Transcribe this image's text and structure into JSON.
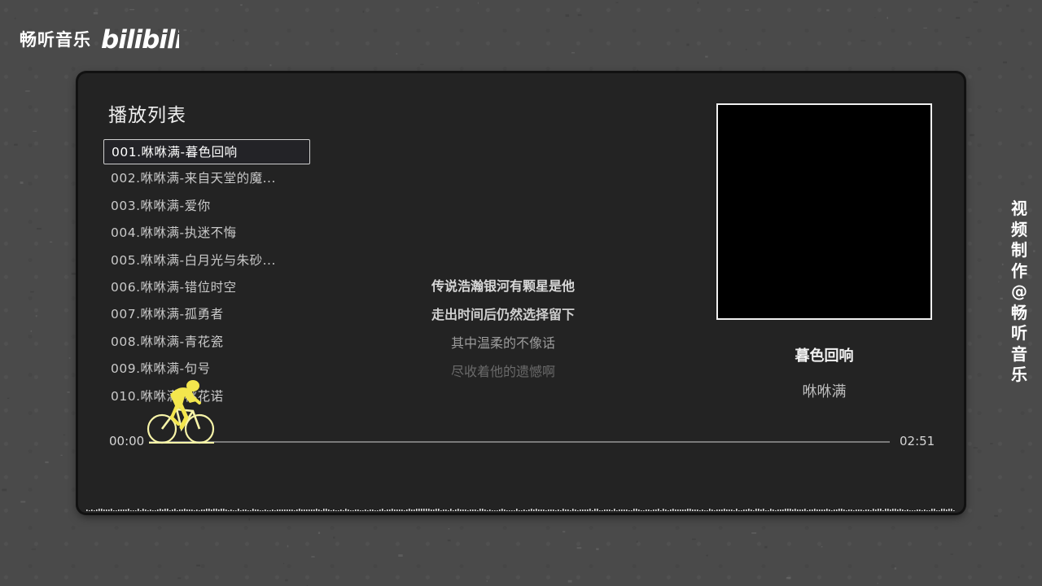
{
  "brand": {
    "name": "畅听音乐",
    "logo_text": "bilibili",
    "logo_icon": "bilibili-logo-icon"
  },
  "credit": [
    "视",
    "频",
    "制",
    "作",
    "@",
    "畅",
    "听",
    "音",
    "乐"
  ],
  "playlist": {
    "title": "播放列表",
    "items": [
      {
        "label": "001.咻咻满-暮色回响",
        "active": true
      },
      {
        "label": "002.咻咻满-来自天堂的魔...",
        "active": false
      },
      {
        "label": "003.咻咻满-爱你",
        "active": false
      },
      {
        "label": "004.咻咻满-执迷不悔",
        "active": false
      },
      {
        "label": "005.咻咻满-白月光与朱砂...",
        "active": false
      },
      {
        "label": "006.咻咻满-错位时空",
        "active": false
      },
      {
        "label": "007.咻咻满-孤勇者",
        "active": false
      },
      {
        "label": "008.咻咻满-青花瓷",
        "active": false
      },
      {
        "label": "009.咻咻满-句号",
        "active": false
      },
      {
        "label": "010.咻咻满-桃花诺",
        "active": false
      }
    ]
  },
  "lyrics": [
    "传说浩瀚银河有颗星是他",
    "走出时间后仍然选择留下",
    "其中温柔的不像话",
    "尽收着他的遗憾啊"
  ],
  "now_playing": {
    "title": "暮色回响",
    "artist": "咻咻满",
    "cover_color": "#000000"
  },
  "player": {
    "current_time": "00:00",
    "total_time": "02:51",
    "progress": 0.0,
    "progress_color": "#f5f27a",
    "progress_icon": "cyclist-icon"
  }
}
